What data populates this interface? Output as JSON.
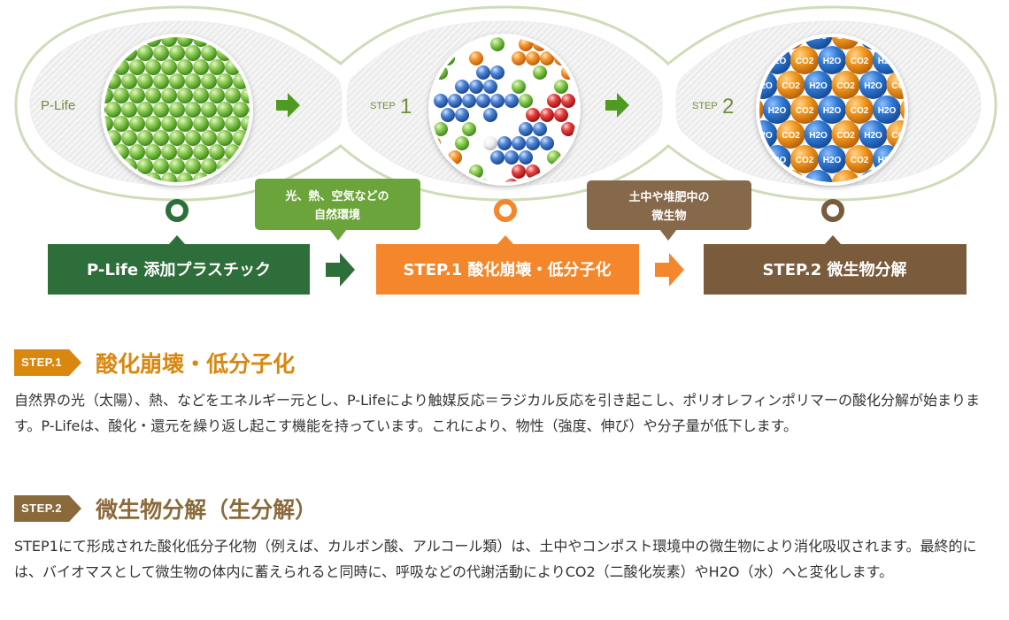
{
  "diagram": {
    "stage_labels": {
      "plife": "P-Life",
      "step1": "STEP",
      "step1_num": "1",
      "step2": "STEP",
      "step2_num": "2"
    },
    "molecule_labels": {
      "co2": "CO2",
      "h2o": "H2O"
    },
    "boxes": {
      "plife": "P-Life 添加プラスチック",
      "step1": "STEP.1 酸化崩壊・低分子化",
      "step2": "STEP.2 微生物分解"
    },
    "callouts": {
      "step1_line1": "光、熱、空気などの",
      "step1_line2": "自然環境",
      "step2_line1": "土中や堆肥中の",
      "step2_line2": "微生物"
    },
    "colors": {
      "green": "#2e6e3a",
      "orange": "#f4862c",
      "brown": "#7a5b3c",
      "ball_green": "#7cc144",
      "ball_blue": "#3a6fbf"
    }
  },
  "sections": [
    {
      "badge": "STEP.1",
      "title": "酸化崩壊・低分子化",
      "text": "自然界の光（太陽）、熱、などをエネルギー元とし、P-Lifeにより触媒反応＝ラジカル反応を引き起こし、ポリオレフィンポリマーの酸化分解が始まります。P-Lifeは、酸化・還元を繰り返し起こす機能を持っています。これにより、物性（強度、伸び）や分子量が低下します。",
      "color": "#d9870f"
    },
    {
      "badge": "STEP.2",
      "title": "微生物分解（生分解）",
      "text": "STEP1にて形成された酸化低分子化物（例えば、カルボン酸、アルコール類）は、土中やコンポスト環境中の微生物により消化吸収されます。最終的には、バイオマスとして微生物の体内に蓄えられると同時に、呼吸などの代謝活動によりCO2（二酸化炭素）やH2O（水）へと変化します。",
      "color": "#8a6a3b"
    }
  ]
}
